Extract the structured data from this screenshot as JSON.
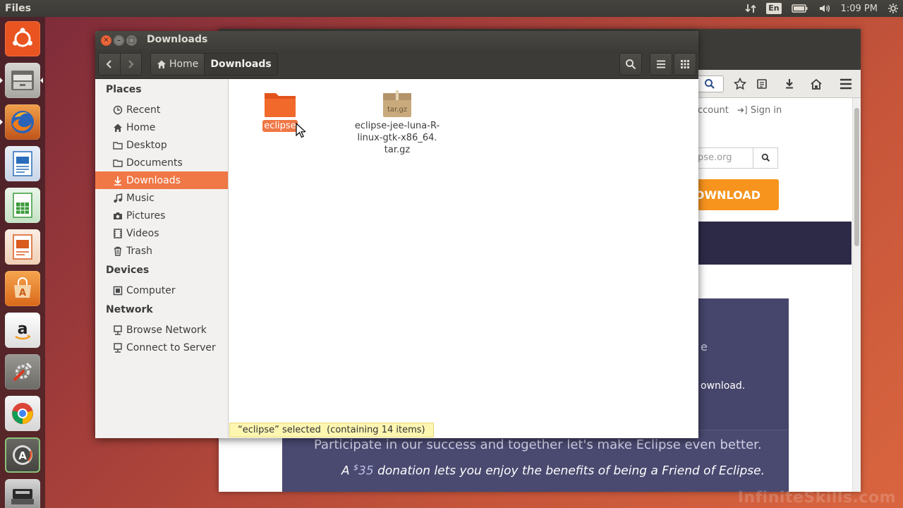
{
  "top_panel": {
    "app_title": "Files",
    "keyboard_layout": "En",
    "clock": "1:09 PM"
  },
  "launcher": {
    "items": [
      {
        "name": "dash-icon",
        "color": "#e95420"
      },
      {
        "name": "files-icon",
        "color": "#8c8a85"
      },
      {
        "name": "firefox-icon",
        "color": "#e66000"
      },
      {
        "name": "writer-icon",
        "color": "#2a6ebb"
      },
      {
        "name": "calc-icon",
        "color": "#3b9b3b"
      },
      {
        "name": "impress-icon",
        "color": "#d95b1e"
      },
      {
        "name": "software-center-icon",
        "color": "#e8841e"
      },
      {
        "name": "amazon-icon",
        "color": "#333333"
      },
      {
        "name": "system-settings-icon",
        "color": "#7a7a7a"
      },
      {
        "name": "chrome-icon",
        "color": "#4285f4"
      },
      {
        "name": "updater-icon",
        "color": "#5a5a5a"
      },
      {
        "name": "scanner-icon",
        "color": "#3a3a3a"
      }
    ]
  },
  "browser": {
    "account_text": "ccount",
    "sign_in": "Sign in",
    "search_placeholder": "pse.org",
    "download_button": "OWNLOAD",
    "side_text_e": "e",
    "side_text_download": "ownload.",
    "feature_line1": "Participate in our success and together let's make Eclipse even better.",
    "feature_line2_a": "A",
    "feature_line2_sup": "$",
    "feature_line2_amount": "35",
    "feature_line2_b": "donation lets you enjoy the benefits of being a Friend of Eclipse."
  },
  "file_manager": {
    "window_title": "Downloads",
    "breadcrumbs": {
      "home": "Home",
      "current": "Downloads"
    },
    "sidebar": {
      "places_header": "Places",
      "places": [
        {
          "label": "Recent",
          "icon": "recent-icon"
        },
        {
          "label": "Home",
          "icon": "home-icon"
        },
        {
          "label": "Desktop",
          "icon": "desktop-icon"
        },
        {
          "label": "Documents",
          "icon": "documents-icon"
        },
        {
          "label": "Downloads",
          "icon": "downloads-icon",
          "selected": true
        },
        {
          "label": "Music",
          "icon": "music-icon"
        },
        {
          "label": "Pictures",
          "icon": "pictures-icon"
        },
        {
          "label": "Videos",
          "icon": "videos-icon"
        },
        {
          "label": "Trash",
          "icon": "trash-icon"
        }
      ],
      "devices_header": "Devices",
      "devices": [
        {
          "label": "Computer",
          "icon": "computer-icon"
        }
      ],
      "network_header": "Network",
      "network": [
        {
          "label": "Browse Network",
          "icon": "network-icon"
        },
        {
          "label": "Connect to Server",
          "icon": "server-icon"
        }
      ]
    },
    "files": [
      {
        "name": "eclipse",
        "type": "folder",
        "selected": true
      },
      {
        "name": "eclipse-jee-luna-R-linux-gtk-x86_64.tar.gz",
        "label_lines": [
          "eclipse-jee-luna-R-",
          "linux-gtk-x86_64.",
          "tar.gz"
        ],
        "type": "archive",
        "icon_text": "tar.gz"
      }
    ],
    "status": "“eclipse” selected  (containing 14 items)",
    "accent_color": "#f07746"
  },
  "watermark": "InfiniteSkills.com"
}
